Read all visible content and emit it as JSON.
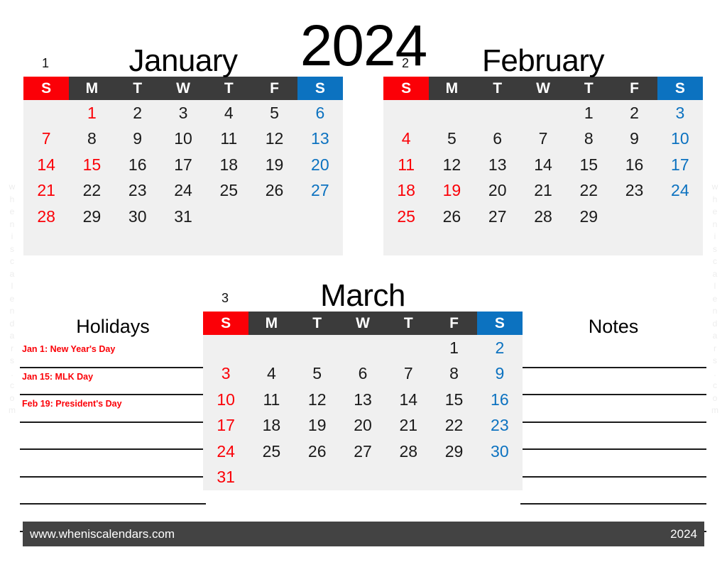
{
  "document": {
    "year_title": "2024",
    "theme": {
      "sunday_red": "#fb0007",
      "saturday_blue": "#0c72c0",
      "header_gray": "#3b3b3b",
      "grid_background": "#f0f0f0",
      "footer_gray": "#434343"
    },
    "watermark_text": "wheniscalendars.com"
  },
  "weekday_headers": [
    "S",
    "M",
    "T",
    "W",
    "T",
    "F",
    "S"
  ],
  "months": [
    {
      "number": "1",
      "name": "January",
      "weeks": [
        [
          "",
          "1",
          "2",
          "3",
          "4",
          "5",
          "6"
        ],
        [
          "7",
          "8",
          "9",
          "10",
          "11",
          "12",
          "13"
        ],
        [
          "14",
          "15",
          "16",
          "17",
          "18",
          "19",
          "20"
        ],
        [
          "21",
          "22",
          "23",
          "24",
          "25",
          "26",
          "27"
        ],
        [
          "28",
          "29",
          "30",
          "31",
          "",
          "",
          ""
        ],
        [
          "",
          "",
          "",
          "",
          "",
          "",
          ""
        ]
      ],
      "holiday_days": [
        "1",
        "15"
      ]
    },
    {
      "number": "2",
      "name": "February",
      "weeks": [
        [
          "",
          "",
          "",
          "",
          "1",
          "2",
          "3"
        ],
        [
          "4",
          "5",
          "6",
          "7",
          "8",
          "9",
          "10"
        ],
        [
          "11",
          "12",
          "13",
          "14",
          "15",
          "16",
          "17"
        ],
        [
          "18",
          "19",
          "20",
          "21",
          "22",
          "23",
          "24"
        ],
        [
          "25",
          "26",
          "27",
          "28",
          "29",
          "",
          ""
        ],
        [
          "",
          "",
          "",
          "",
          "",
          "",
          ""
        ]
      ],
      "holiday_days": [
        "19"
      ]
    },
    {
      "number": "3",
      "name": "March",
      "weeks": [
        [
          "",
          "",
          "",
          "",
          "",
          "1",
          "2"
        ],
        [
          "3",
          "4",
          "5",
          "6",
          "7",
          "8",
          "9"
        ],
        [
          "10",
          "11",
          "12",
          "13",
          "14",
          "15",
          "16"
        ],
        [
          "17",
          "18",
          "19",
          "20",
          "21",
          "22",
          "23"
        ],
        [
          "24",
          "25",
          "26",
          "27",
          "28",
          "29",
          "30"
        ],
        [
          "31",
          "",
          "",
          "",
          "",
          "",
          ""
        ]
      ],
      "holiday_days": []
    }
  ],
  "holidays_panel": {
    "title": "Holidays",
    "entries": [
      "Jan 1: New Year's Day",
      "Jan 15: MLK Day",
      "Feb 19: President's Day",
      "",
      "",
      "",
      ""
    ]
  },
  "notes_panel": {
    "title": "Notes",
    "entries": [
      "",
      "",
      "",
      "",
      "",
      "",
      ""
    ]
  },
  "footer": {
    "url": "www.wheniscalendars.com",
    "year": "2024"
  }
}
